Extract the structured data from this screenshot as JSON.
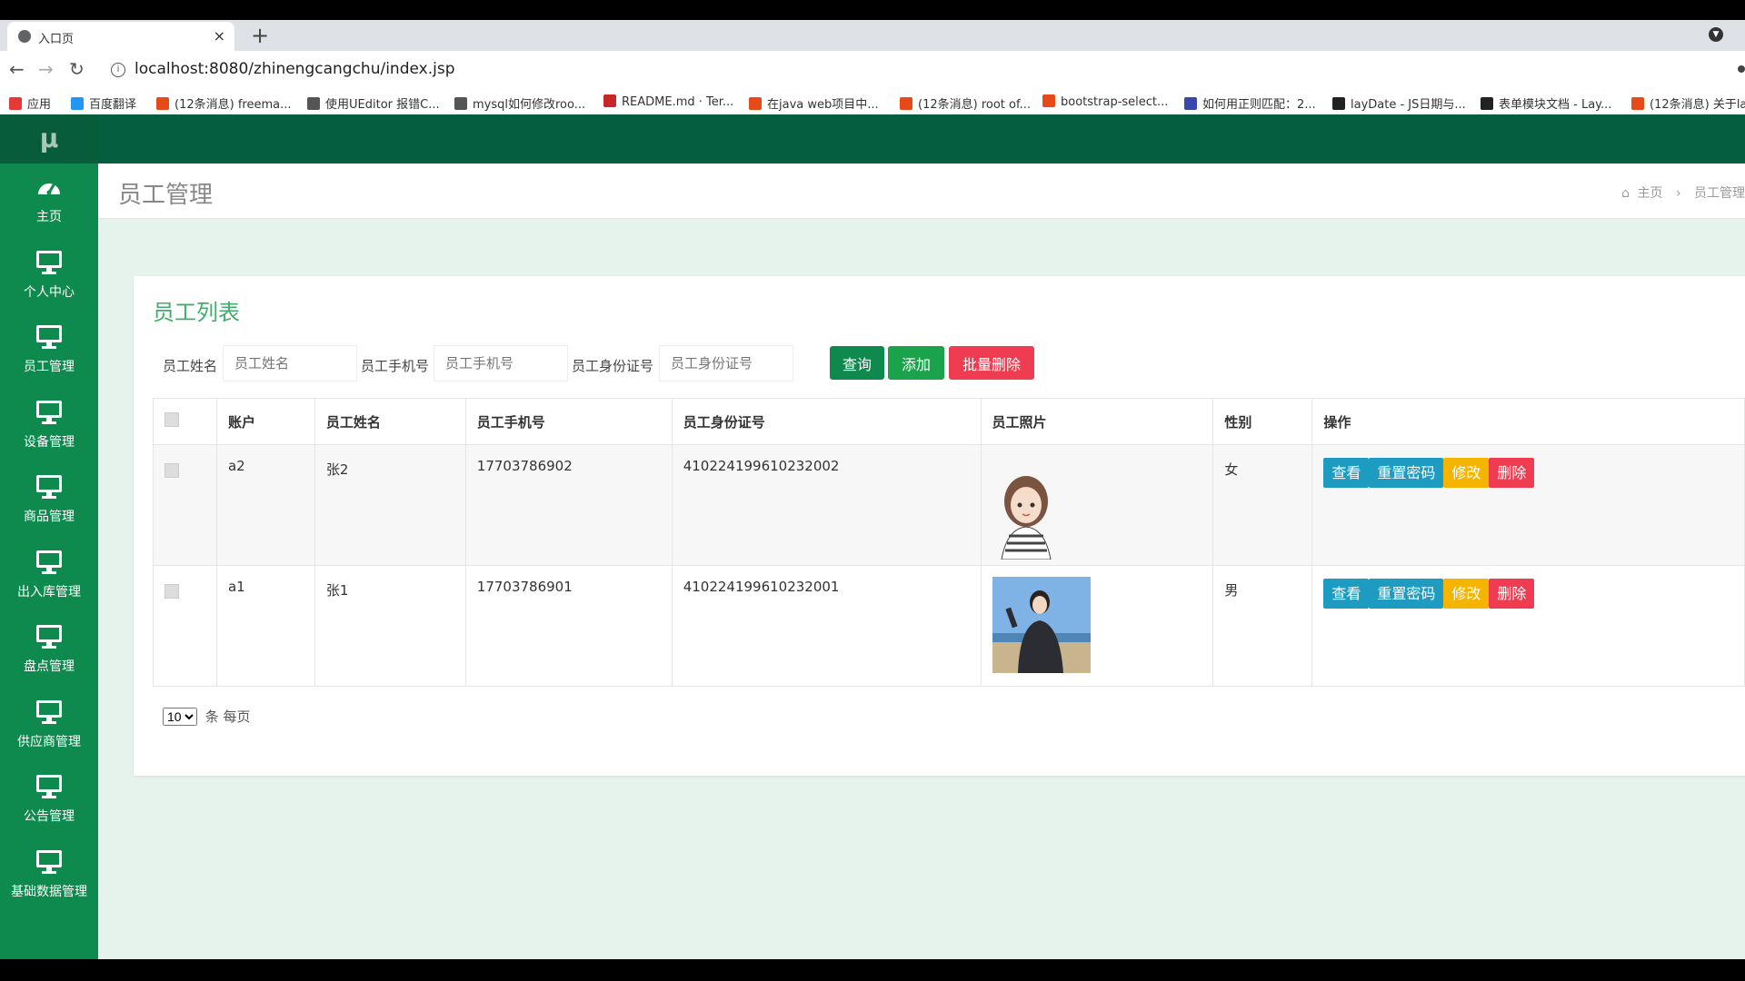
{
  "browser": {
    "tab_title": "入口页",
    "url": "localhost:8080/zhinengcangchu/index.jsp",
    "bookmarks": [
      {
        "label": "应用",
        "color": "#e53935"
      },
      {
        "label": "百度翻译",
        "color": "#2196f3"
      },
      {
        "label": "(12条消息) freema...",
        "color": "#e64a19"
      },
      {
        "label": "使用UEditor 报错C...",
        "color": "#555555"
      },
      {
        "label": "mysql如何修改roo...",
        "color": "#555555"
      },
      {
        "label": "README.md · Ter...",
        "color": "#c62828"
      },
      {
        "label": "在java web项目中...",
        "color": "#e64a19"
      },
      {
        "label": "(12条消息) root of...",
        "color": "#e64a19"
      },
      {
        "label": "bootstrap-select...",
        "color": "#e64a19"
      },
      {
        "label": "如何用正则匹配：2...",
        "color": "#3949ab"
      },
      {
        "label": "layDate - JS日期与...",
        "color": "#222222"
      },
      {
        "label": "表单模块文档 - Lay...",
        "color": "#222222"
      },
      {
        "label": "(12条消息) 关于la",
        "color": "#e64a19"
      }
    ]
  },
  "sidebar": {
    "logo": "μ",
    "items": [
      {
        "label": "主页",
        "icon": "dashboard-icon"
      },
      {
        "label": "个人中心",
        "icon": "monitor-icon"
      },
      {
        "label": "员工管理",
        "icon": "monitor-icon"
      },
      {
        "label": "设备管理",
        "icon": "monitor-icon"
      },
      {
        "label": "商品管理",
        "icon": "monitor-icon"
      },
      {
        "label": "出入库管理",
        "icon": "monitor-icon"
      },
      {
        "label": "盘点管理",
        "icon": "monitor-icon"
      },
      {
        "label": "供应商管理",
        "icon": "monitor-icon"
      },
      {
        "label": "公告管理",
        "icon": "monitor-icon"
      },
      {
        "label": "基础数据管理",
        "icon": "monitor-icon"
      }
    ]
  },
  "page": {
    "title": "员工管理",
    "breadcrumb_home": "主页",
    "breadcrumb_current": "员工管理"
  },
  "card": {
    "title": "员工列表",
    "search": {
      "name_label": "员工姓名",
      "name_placeholder": "员工姓名",
      "phone_label": "员工手机号",
      "phone_placeholder": "员工手机号",
      "id_label": "员工身份证号",
      "id_placeholder": "员工身份证号"
    },
    "buttons": {
      "query": "查询",
      "add": "添加",
      "batch_delete": "批量删除"
    },
    "table": {
      "headers": {
        "account": "账户",
        "name": "员工姓名",
        "phone": "员工手机号",
        "idcard": "员工身份证号",
        "photo": "员工照片",
        "gender": "性别",
        "ops": "操作"
      },
      "rows": [
        {
          "account": "a2",
          "name": "张2",
          "phone": "17703786902",
          "idcard": "410224199610232002",
          "gender": "女"
        },
        {
          "account": "a1",
          "name": "张1",
          "phone": "17703786901",
          "idcard": "410224199610232001",
          "gender": "男"
        }
      ],
      "row_ops": {
        "view": "查看",
        "reset": "重置密码",
        "edit": "修改",
        "delete": "删除"
      }
    },
    "pager": {
      "page_size": "10",
      "suffix": "条 每页"
    }
  },
  "colors": {
    "sidebar": "#0e8a4e",
    "topbar": "#055e3f",
    "btn_query": "#0e8a4e",
    "btn_add": "#1aa34a",
    "btn_danger": "#f03c50",
    "op_view": "#1e9bc0",
    "op_reset": "#1e9bc0",
    "op_edit": "#f5b400",
    "op_delete": "#f03c50"
  }
}
